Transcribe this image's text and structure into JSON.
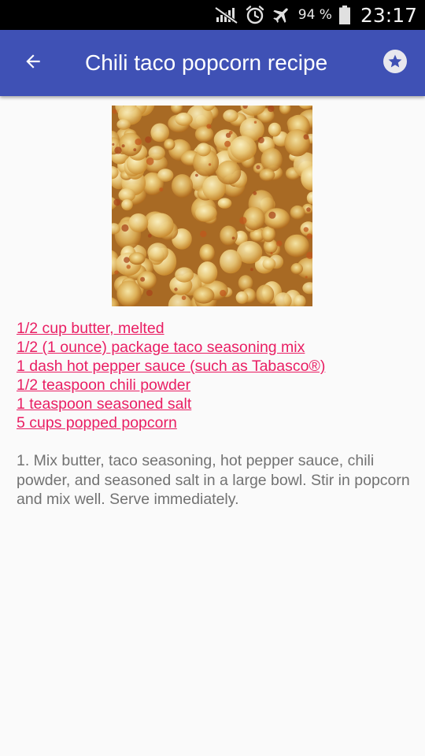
{
  "status_bar": {
    "battery_percent": "94 %",
    "time": "23:17",
    "icons": [
      "signal-muted-icon",
      "alarm-icon",
      "airplane-mode-icon",
      "battery-icon"
    ]
  },
  "app_bar": {
    "title": "Chili taco popcorn recipe",
    "back_icon": "arrow-back-icon",
    "favorite_icon": "star-icon",
    "color": "#3f51b5"
  },
  "recipe": {
    "image": "popcorn-photo",
    "ingredients": [
      "1/2 cup butter, melted",
      "1/2 (1 ounce) package taco seasoning mix",
      "1 dash hot pepper sauce (such as Tabasco®)",
      "1/2 teaspoon chili powder",
      "1 teaspoon seasoned salt",
      "5 cups popped popcorn"
    ],
    "instructions": "1. Mix butter, taco seasoning, hot pepper sauce, chili powder, and seasoned salt in a large bowl. Stir in popcorn and mix well. Serve immediately.",
    "link_color": "#e91e63",
    "text_color": "#727272"
  }
}
